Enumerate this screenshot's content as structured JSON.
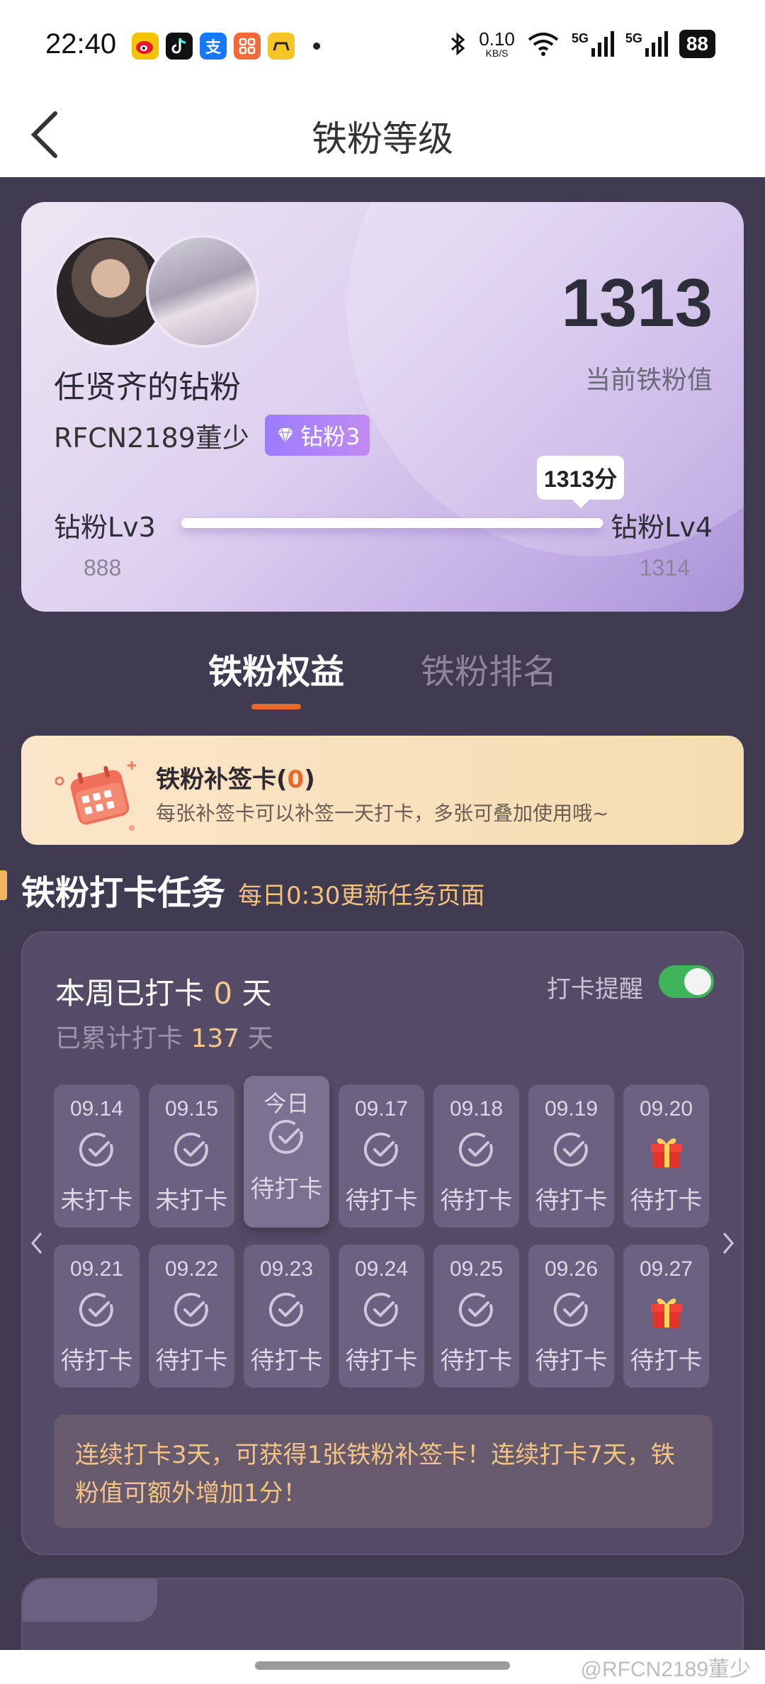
{
  "status_bar": {
    "time": "22:40",
    "speed_value": "0.10",
    "speed_unit": "KB/S",
    "network_1": "5G",
    "network_2": "5G",
    "battery": "88"
  },
  "nav": {
    "title": "铁粉等级"
  },
  "profile": {
    "fan_name": "任贤齐的钻粉",
    "username": "RFCN2189董少",
    "badge": "钻粉3",
    "score": "1313",
    "score_label": "当前铁粉值",
    "level_current": "钻粉Lv3",
    "level_next": "钻粉Lv4",
    "level_current_min": "888",
    "level_next_min": "1314",
    "progress_tip": "1313分",
    "progress_fraction": 0.9978
  },
  "tabs": [
    {
      "label": "铁粉权益",
      "active": true
    },
    {
      "label": "铁粉排名",
      "active": false
    }
  ],
  "supplement": {
    "title": "铁粉补签卡(",
    "count": "0",
    "title_end": ")",
    "desc": "每张补签卡可以补签一天打卡，多张可叠加使用哦~"
  },
  "section": {
    "title": "铁粉打卡任务",
    "subtitle": "每日0:30更新任务页面"
  },
  "checkin": {
    "week_prefix": "本周已打卡 ",
    "week_days": "0",
    "week_suffix": " 天",
    "total_prefix": "已累计打卡 ",
    "total_days": "137",
    "total_suffix": " 天",
    "reminder_label": "打卡提醒",
    "reminder_on": true,
    "rows": [
      [
        {
          "date": "09.14",
          "status": "未打卡",
          "icon": "check-circle-icon"
        },
        {
          "date": "09.15",
          "status": "未打卡",
          "icon": "check-circle-icon"
        },
        {
          "date": "今日",
          "status": "待打卡",
          "icon": "check-circle-icon",
          "today": true
        },
        {
          "date": "09.17",
          "status": "待打卡",
          "icon": "check-circle-icon"
        },
        {
          "date": "09.18",
          "status": "待打卡",
          "icon": "check-circle-icon"
        },
        {
          "date": "09.19",
          "status": "待打卡",
          "icon": "check-circle-icon"
        },
        {
          "date": "09.20",
          "status": "待打卡",
          "icon": "gift-icon"
        }
      ],
      [
        {
          "date": "09.21",
          "status": "待打卡",
          "icon": "check-circle-icon"
        },
        {
          "date": "09.22",
          "status": "待打卡",
          "icon": "check-circle-icon"
        },
        {
          "date": "09.23",
          "status": "待打卡",
          "icon": "check-circle-icon"
        },
        {
          "date": "09.24",
          "status": "待打卡",
          "icon": "check-circle-icon"
        },
        {
          "date": "09.25",
          "status": "待打卡",
          "icon": "check-circle-icon"
        },
        {
          "date": "09.26",
          "status": "待打卡",
          "icon": "check-circle-icon"
        },
        {
          "date": "09.27",
          "status": "待打卡",
          "icon": "gift-icon"
        }
      ]
    ],
    "tip": "连续打卡3天，可获得1张铁粉补签卡！连续打卡7天，铁粉值可额外增加1分！"
  },
  "watermark": "@RFCN2189董少",
  "colors": {
    "accent": "#e8682f",
    "highlight": "#f6c88b",
    "panel": "#544c66",
    "toggle_on": "#3fb45a"
  }
}
